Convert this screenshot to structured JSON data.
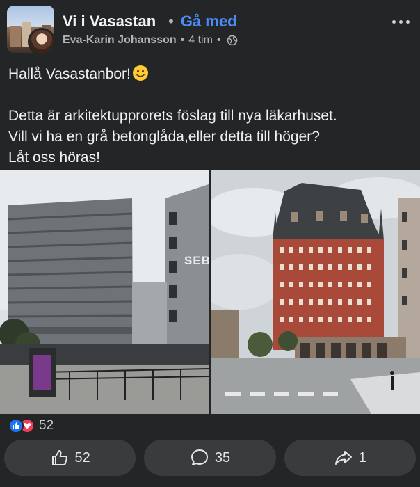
{
  "header": {
    "group_name": "Vi i Vasastan",
    "separator": "•",
    "join_label": "Gå med",
    "author": "Eva-Karin Johansson",
    "meta_sep": "•",
    "time": "4 tim",
    "meta_sep2": "•",
    "privacy_icon": "globe-icon",
    "more_icon": "more-icon"
  },
  "post": {
    "line1": "Hallå Vasastanbor!",
    "line1_emoji": "smiling-face-emoji",
    "line2": "Detta är arkitektupprorets föslag till nya läkarhuset.",
    "line3": "Vill vi ha en grå betonglåda,eller detta till höger?",
    "line4": "Låt oss höras!"
  },
  "photos": {
    "left_sign": "SEB",
    "right_description_icon": "red-brick-castle-building"
  },
  "reactions": {
    "icons": [
      "like-icon",
      "love-icon"
    ],
    "count": "52"
  },
  "actions": {
    "like_count": "52",
    "comment_count": "35",
    "share_count": "1"
  },
  "colors": {
    "background": "#242526",
    "button_bg": "#3a3b3c",
    "link": "#4b8df8",
    "like": "#1877f2",
    "love": "#f33e58"
  }
}
